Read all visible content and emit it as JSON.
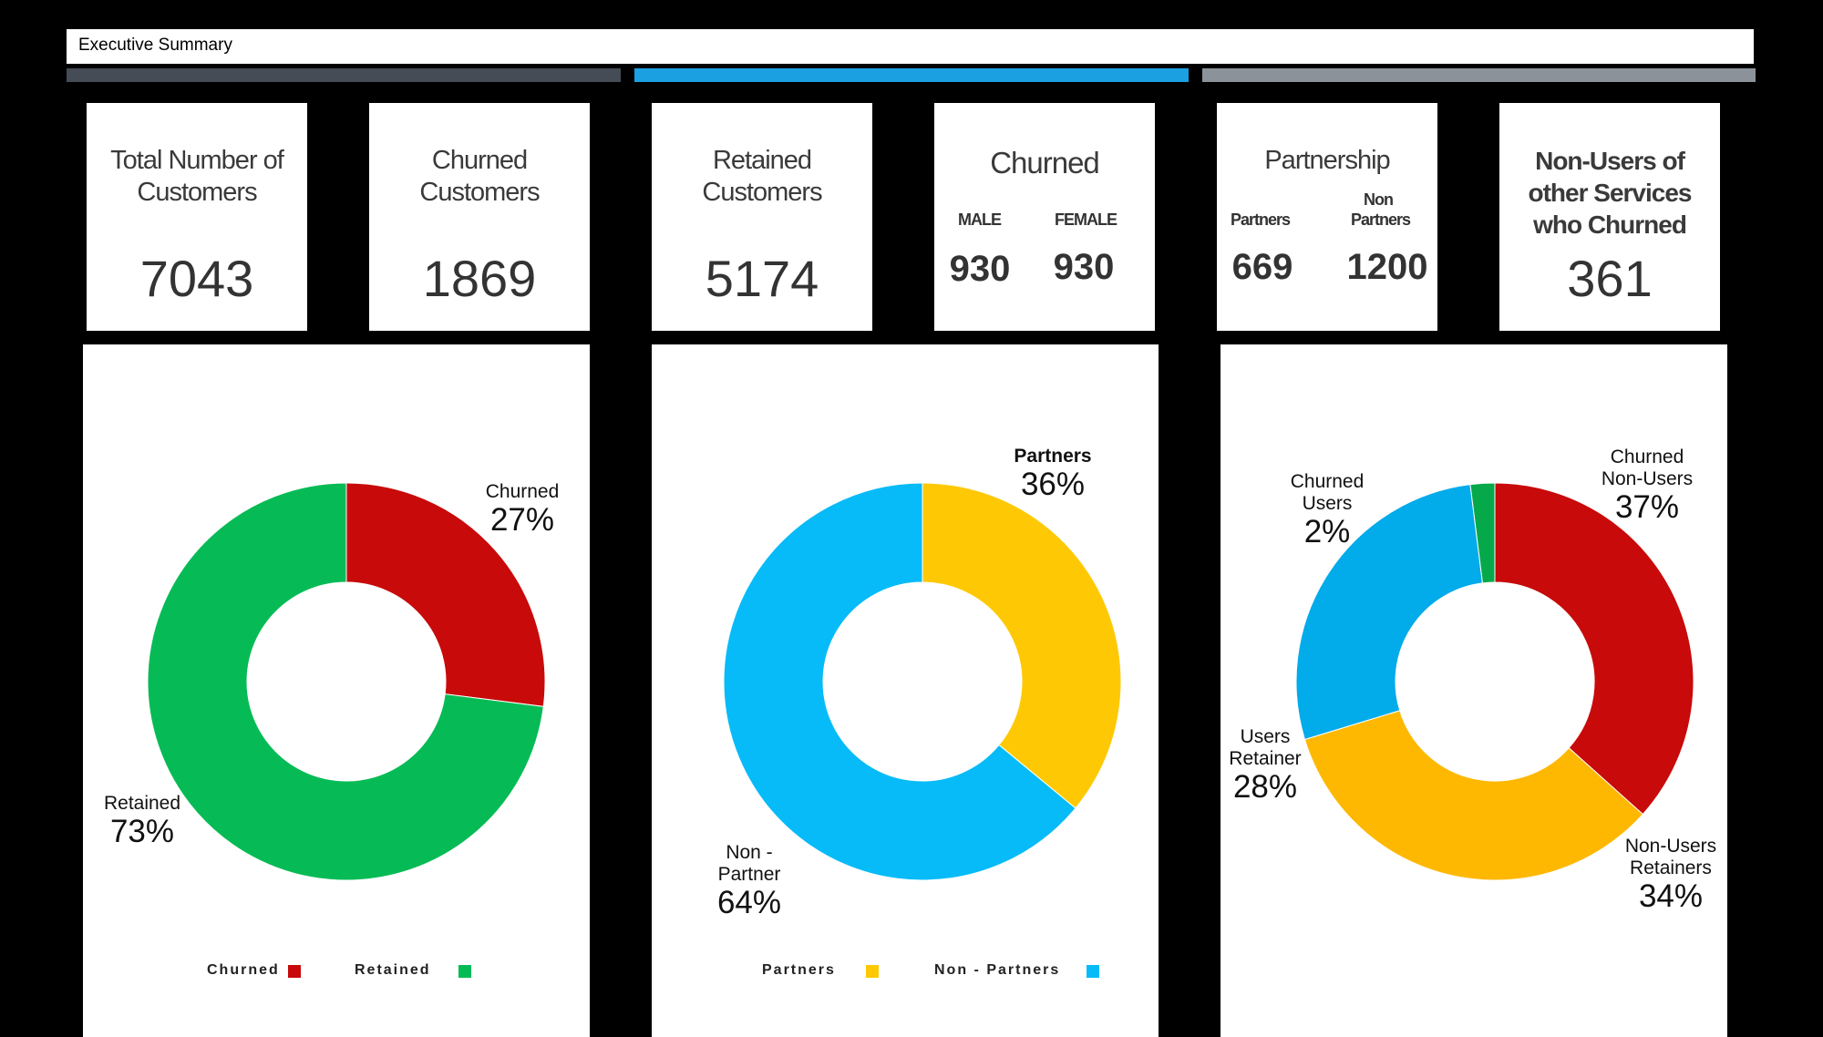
{
  "header": {
    "title": "Executive Summary"
  },
  "bands": [
    "#454c55",
    "#1ba0e1",
    "#8b9299"
  ],
  "cards": {
    "total": {
      "label": "Total Number of Customers",
      "value": "7043"
    },
    "churned": {
      "label": "Churned Customers",
      "value": "1869"
    },
    "retained": {
      "label": "Retained Customers",
      "value": "5174"
    },
    "gender": {
      "label": "Churned",
      "male_label": "MALE",
      "female_label": "FEMALE",
      "male_value": "930",
      "female_value": "930"
    },
    "partnership": {
      "label": "Partnership",
      "partners_label": "Partners",
      "non_partners_label": "Non Partners",
      "partners_value": "669",
      "non_partners_value": "1200"
    },
    "non_users": {
      "label": "Non-Users of other Services who Churned",
      "value": "361"
    }
  },
  "chart_data": [
    {
      "type": "pie",
      "slices": [
        {
          "label": "Churned",
          "value": 27,
          "display": "27%",
          "color": "#c80a0a"
        },
        {
          "label": "Retained",
          "value": 73,
          "display": "73%",
          "color": "#06bb55"
        }
      ],
      "legend": [
        {
          "label": "Churned",
          "color": "#c80a0a"
        },
        {
          "label": "Retained",
          "color": "#06bb55"
        }
      ],
      "legend_placement": "bottom"
    },
    {
      "type": "pie",
      "slices": [
        {
          "label": "Partners",
          "value": 36,
          "display": "36%",
          "color": "#fec904"
        },
        {
          "label": "Non - Partner",
          "value": 64,
          "display": "64%",
          "color": "#07bbf8"
        }
      ],
      "legend": [
        {
          "label": "Partners",
          "color": "#fec904"
        },
        {
          "label": "Non - Partners",
          "color": "#07bbf8"
        }
      ],
      "legend_placement": "bottom"
    },
    {
      "type": "pie",
      "slices": [
        {
          "label": "Churned Non-Users",
          "value": 37,
          "display": "37%",
          "color": "#c80a0a"
        },
        {
          "label": "Non-Users Retainers",
          "value": 34,
          "display": "34%",
          "color": "#feb802"
        },
        {
          "label": "Users Retainer",
          "value": 28,
          "display": "28%",
          "color": "#02abea"
        },
        {
          "label": "Churned Users",
          "value": 2,
          "display": "2%",
          "color": "#06a94a"
        }
      ]
    }
  ]
}
